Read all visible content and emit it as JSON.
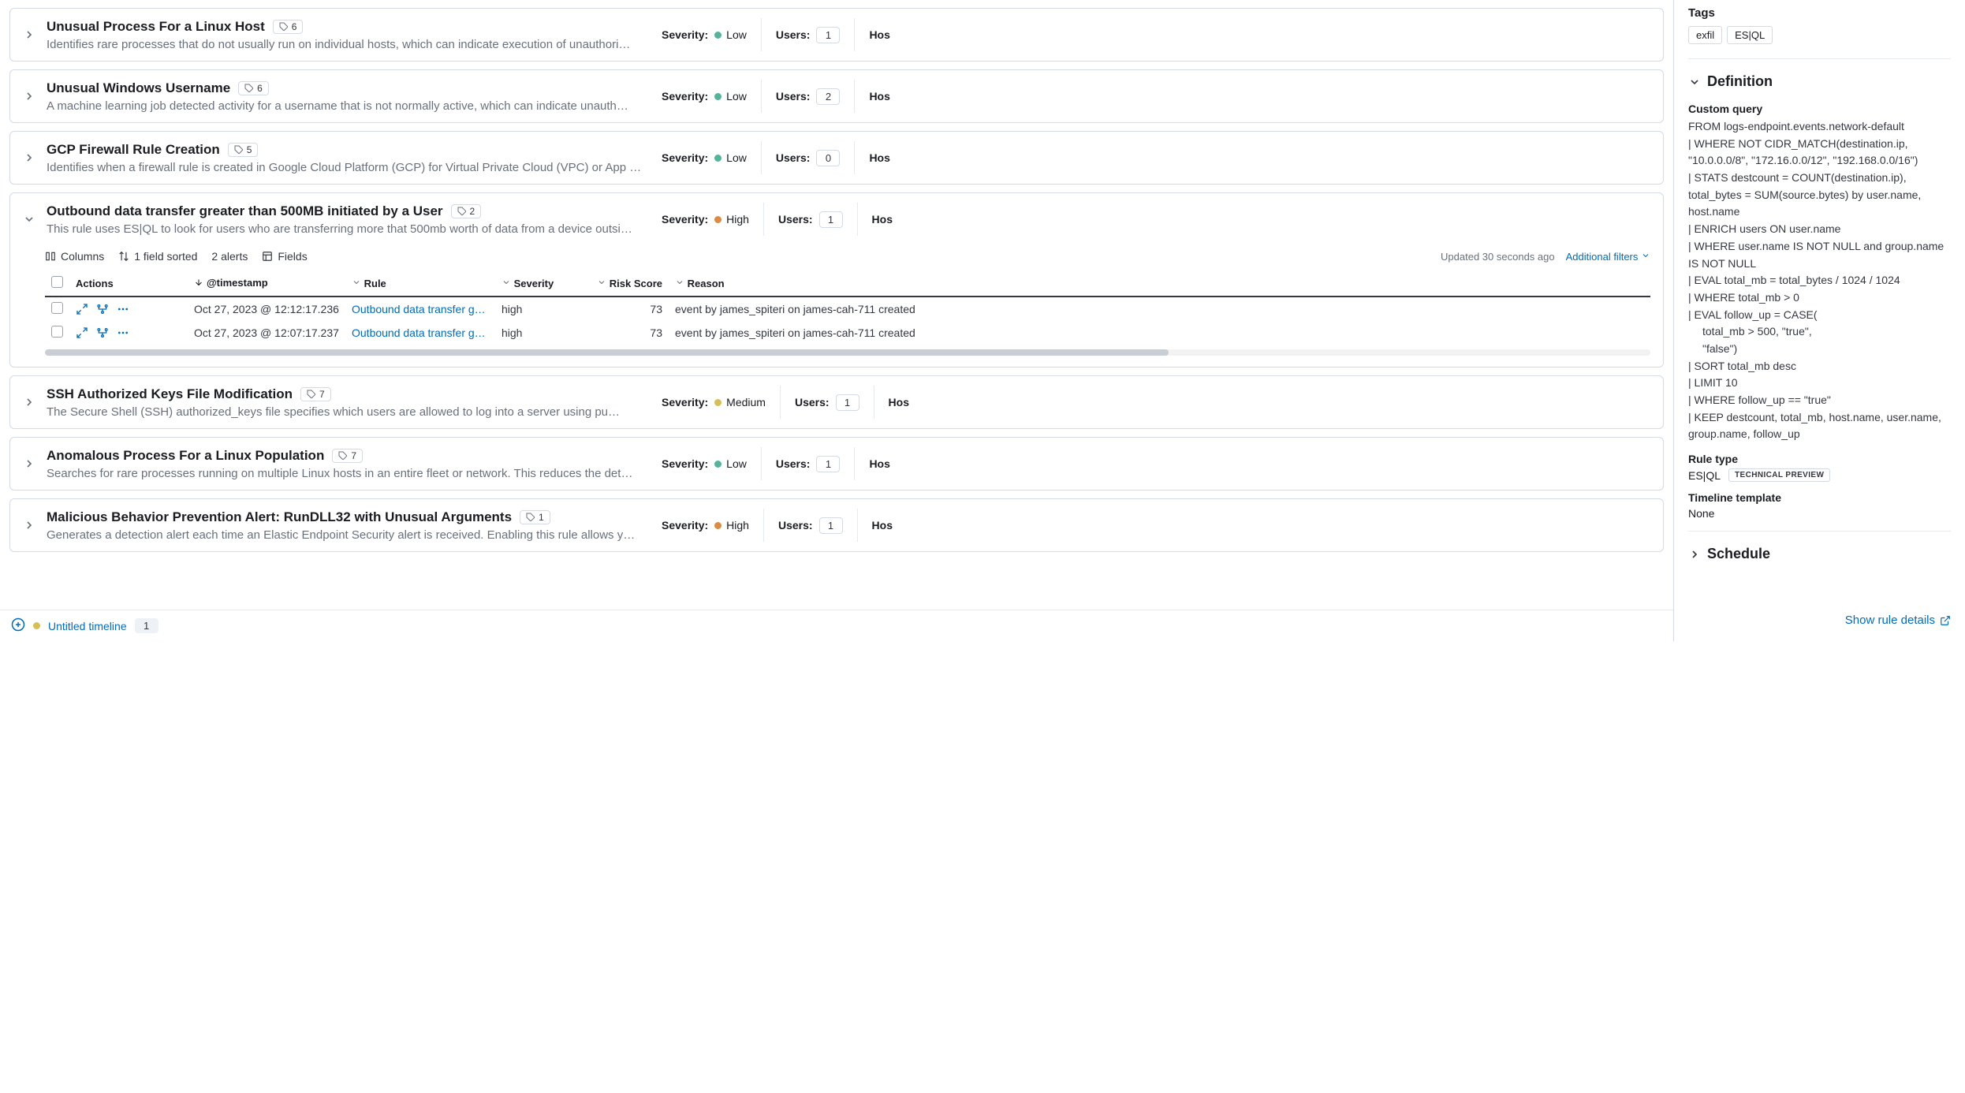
{
  "rules": [
    {
      "title": "Unusual Process For a Linux Host",
      "count": 6,
      "desc": "Identifies rare processes that do not usually run on individual hosts, which can indicate execution of unauthori…",
      "severity": "Low",
      "sevClass": "low",
      "users": 1,
      "hostLabel": "Hos"
    },
    {
      "title": "Unusual Windows Username",
      "count": 6,
      "desc": "A machine learning job detected activity for a username that is not normally active, which can indicate unauth…",
      "severity": "Low",
      "sevClass": "low",
      "users": 2,
      "hostLabel": "Hos"
    },
    {
      "title": "GCP Firewall Rule Creation",
      "count": 5,
      "desc": "Identifies when a firewall rule is created in Google Cloud Platform (GCP) for Virtual Private Cloud (VPC) or App …",
      "severity": "Low",
      "sevClass": "low",
      "users": 0,
      "hostLabel": "Hos"
    },
    {
      "title": "Outbound data transfer greater than 500MB initiated by a User",
      "count": 2,
      "desc": "This rule uses ES|QL to look for users who are transferring more that 500mb worth of data from a device outsi…",
      "severity": "High",
      "sevClass": "high",
      "users": 1,
      "hostLabel": "Hos",
      "expanded": true
    },
    {
      "title": "SSH Authorized Keys File Modification",
      "count": 7,
      "desc": "The Secure Shell (SSH) authorized_keys file specifies which users are allowed to log into a server using pu…",
      "severity": "Medium",
      "sevClass": "medium",
      "users": 1,
      "hostLabel": "Hos"
    },
    {
      "title": "Anomalous Process For a Linux Population",
      "count": 7,
      "desc": "Searches for rare processes running on multiple Linux hosts in an entire fleet or network. This reduces the det…",
      "severity": "Low",
      "sevClass": "low",
      "users": 1,
      "hostLabel": "Hos"
    },
    {
      "title": "Malicious Behavior Prevention Alert: RunDLL32 with Unusual Arguments",
      "count": 1,
      "desc": "Generates a detection alert each time an Elastic Endpoint Security alert is received. Enabling this rule allows y…",
      "severity": "High",
      "sevClass": "high",
      "users": 1,
      "hostLabel": "Hos"
    }
  ],
  "labels": {
    "severity": "Severity:",
    "users": "Users:"
  },
  "toolbar": {
    "columns": "Columns",
    "sortedFields": "1 field sorted",
    "alertsCount": "2 alerts",
    "fields": "Fields",
    "updated": "Updated 30 seconds ago",
    "additionalFilters": "Additional filters"
  },
  "columns": {
    "actions": "Actions",
    "timestamp": "@timestamp",
    "rule": "Rule",
    "severity": "Severity",
    "riskScore": "Risk Score",
    "reason": "Reason"
  },
  "alerts": [
    {
      "timestamp": "Oct 27, 2023 @ 12:12:17.236",
      "rule": "Outbound data transfer gre…",
      "severity": "high",
      "risk": 73,
      "reason": "event by james_spiteri on james-cah-711 created"
    },
    {
      "timestamp": "Oct 27, 2023 @ 12:07:17.237",
      "rule": "Outbound data transfer gre…",
      "severity": "high",
      "risk": 73,
      "reason": "event by james_spiteri on james-cah-711 created"
    }
  ],
  "footer": {
    "timelineName": "Untitled timeline",
    "timelineCount": 1
  },
  "side": {
    "tagsLabel": "Tags",
    "tags": [
      "exfil",
      "ES|QL"
    ],
    "definitionLabel": "Definition",
    "customQueryLabel": "Custom query",
    "queryLines": [
      "FROM logs-endpoint.events.network-default",
      "| WHERE NOT CIDR_MATCH(destination.ip, \"10.0.0.0/8\", \"172.16.0.0/12\", \"192.168.0.0/16\")",
      "| STATS destcount = COUNT(destination.ip), total_bytes = SUM(source.bytes) by user.name, host.name",
      "| ENRICH users ON user.name",
      "| WHERE user.name IS NOT NULL and group.name IS NOT NULL",
      "| EVAL total_mb = total_bytes / 1024 / 1024",
      "| WHERE total_mb > 0",
      "| EVAL follow_up = CASE(",
      "    total_mb > 500, \"true\",",
      "    \"false\")",
      "| SORT total_mb desc",
      "| LIMIT 10",
      "| WHERE follow_up == \"true\"",
      "| KEEP destcount, total_mb, host.name, user.name, group.name, follow_up"
    ],
    "ruleTypeLabel": "Rule type",
    "ruleTypeValue": "ES|QL",
    "previewBadge": "TECHNICAL PREVIEW",
    "timelineTemplateLabel": "Timeline template",
    "timelineTemplateValue": "None",
    "scheduleLabel": "Schedule",
    "showDetails": "Show rule details"
  }
}
